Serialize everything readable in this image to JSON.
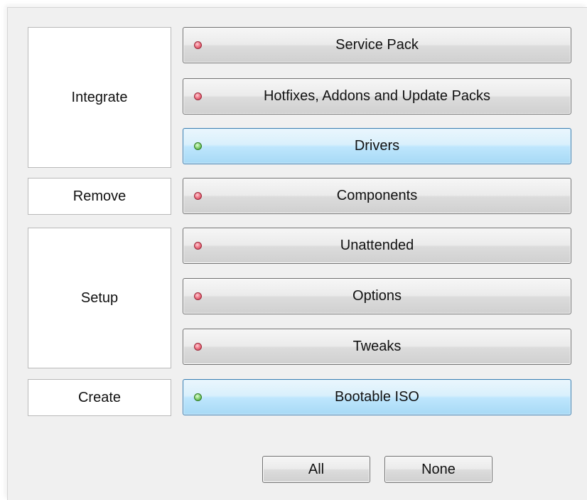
{
  "groups": {
    "integrate": "Integrate",
    "remove": "Remove",
    "setup": "Setup",
    "create": "Create"
  },
  "tasks": [
    {
      "label": "Service Pack",
      "status": "red"
    },
    {
      "label": "Hotfixes, Addons and Update Packs",
      "status": "red"
    },
    {
      "label": "Drivers",
      "status": "green",
      "selected": true
    },
    {
      "label": "Components",
      "status": "red"
    },
    {
      "label": "Unattended",
      "status": "red"
    },
    {
      "label": "Options",
      "status": "red"
    },
    {
      "label": "Tweaks",
      "status": "red"
    },
    {
      "label": "Bootable ISO",
      "status": "green",
      "selected": true
    }
  ],
  "footer": {
    "all_label": "All",
    "none_label": "None"
  },
  "colors": {
    "status_red": "#e0566a",
    "status_green": "#6cc25a",
    "selected_blue": "#a7d9f5"
  }
}
